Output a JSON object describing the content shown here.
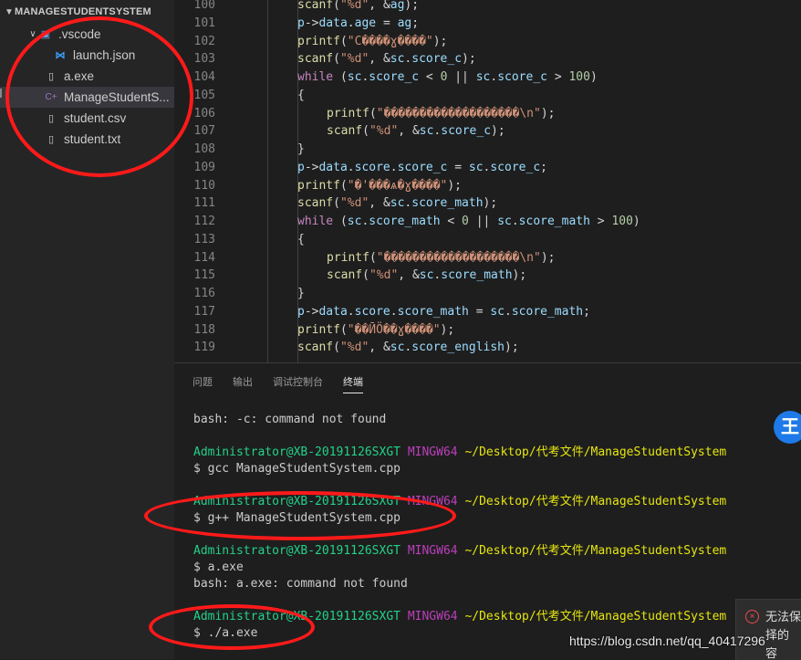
{
  "sidebar": {
    "header": "MANAGESTUDENTSYSTEM",
    "folder": ".vscode",
    "items": [
      {
        "name": "launch.json",
        "icon": "vscode-icon"
      },
      {
        "name": "a.exe",
        "icon": "file-icon"
      },
      {
        "name": "ManageStudentS...",
        "icon": "cpp-icon"
      },
      {
        "name": "student.csv",
        "icon": "file-icon"
      },
      {
        "name": "student.txt",
        "icon": "file-icon"
      }
    ]
  },
  "editor": {
    "lines": [
      {
        "n": "100",
        "indent": 0,
        "t": "scanf(\"%d\", &ag);"
      },
      {
        "n": "101",
        "indent": 0,
        "t": "p->data.age = ag;"
      },
      {
        "n": "102",
        "indent": 0,
        "t": "printf(\"C����ɣ����\");"
      },
      {
        "n": "103",
        "indent": 0,
        "t": "scanf(\"%d\", &sc.score_c);"
      },
      {
        "n": "104",
        "indent": 0,
        "t": "while (sc.score_c < 0 || sc.score_c > 100)"
      },
      {
        "n": "105",
        "indent": 0,
        "t": "{"
      },
      {
        "n": "106",
        "indent": 1,
        "t": "printf(\"�������������������\\n\");"
      },
      {
        "n": "107",
        "indent": 1,
        "t": "scanf(\"%d\", &sc.score_c);"
      },
      {
        "n": "108",
        "indent": 0,
        "t": "}"
      },
      {
        "n": "109",
        "indent": 0,
        "t": "p->data.score.score_c = sc.score_c;"
      },
      {
        "n": "110",
        "indent": 0,
        "t": "printf(\"�'���ѧ�ɣ����\");"
      },
      {
        "n": "111",
        "indent": 0,
        "t": "scanf(\"%d\", &sc.score_math);"
      },
      {
        "n": "112",
        "indent": 0,
        "t": "while (sc.score_math < 0 || sc.score_math > 100)"
      },
      {
        "n": "113",
        "indent": 0,
        "t": "{"
      },
      {
        "n": "114",
        "indent": 1,
        "t": "printf(\"�������������������\\n\");"
      },
      {
        "n": "115",
        "indent": 1,
        "t": "scanf(\"%d\", &sc.score_math);"
      },
      {
        "n": "116",
        "indent": 0,
        "t": "}"
      },
      {
        "n": "117",
        "indent": 0,
        "t": "p->data.score.score_math = sc.score_math;"
      },
      {
        "n": "118",
        "indent": 0,
        "t": "printf(\"��ӢӦ��ɣ����\");"
      },
      {
        "n": "119",
        "indent": 0,
        "t": "scanf(\"%d\", &sc.score_english);"
      }
    ]
  },
  "panel": {
    "tabs": [
      "问题",
      "输出",
      "调试控制台",
      "终端"
    ],
    "active_tab": 3,
    "terminal": {
      "line1": "bash: -c: command not found",
      "user": "Administrator@XB-20191126SXGT",
      "mingw": "MINGW64",
      "path": "~/Desktop/代考文件/ManageStudentSystem",
      "cmd1": "$ gcc ManageStudentSystem.cpp",
      "cmd2": "$ g++ ManageStudentSystem.cpp",
      "cmd3": "$ a.exe",
      "err3": "bash: a.exe: command not found",
      "cmd4": "$ ./a.exe"
    }
  },
  "overlays": {
    "watermark": "https://blog.csdn.net/qq_40417296",
    "notification": "无法保 择的 容",
    "badge": "王"
  },
  "colors": {
    "annotation_circle": "#ff1a1a",
    "terminal_user": "#23d18b",
    "terminal_mingw": "#bc3fbc",
    "terminal_path": "#e5e510"
  }
}
